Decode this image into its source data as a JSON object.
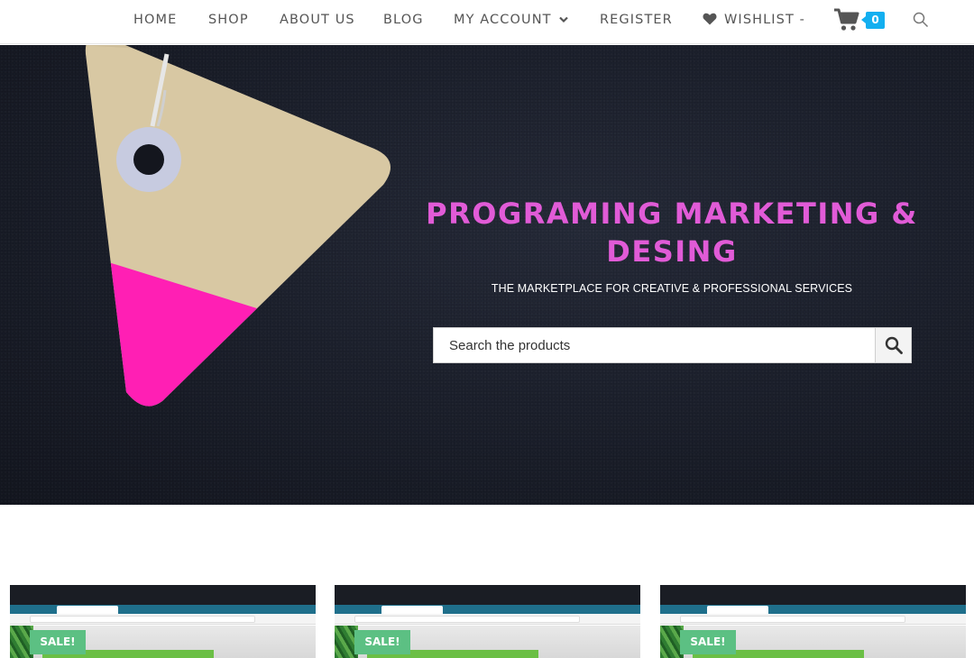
{
  "nav": {
    "items": [
      {
        "label": "HOME"
      },
      {
        "label": "SHOP"
      },
      {
        "label": "ABOUT US"
      },
      {
        "label": "BLOG"
      },
      {
        "label": "MY ACCOUNT"
      },
      {
        "label": "REGISTER"
      },
      {
        "label": "WISHLIST -"
      }
    ],
    "cart_count": "0",
    "icons": [
      "chevron-down-icon",
      "heart-icon",
      "cart-icon",
      "search-icon"
    ]
  },
  "hero": {
    "title": "PROGRAMING MARKETING & DESING",
    "subtitle": "THE MARKETPLACE FOR CREATIVE & PROFESSIONAL SERVICES",
    "search": {
      "placeholder": "Search the products"
    }
  },
  "products": [
    {
      "badge": "SALE!"
    },
    {
      "badge": "SALE!"
    },
    {
      "badge": "SALE!"
    }
  ],
  "colors": {
    "accent": "#e15bd7",
    "hero_bg": "#1c202c",
    "tag_beige": "#d8c8a3",
    "tag_pink": "#ff1fb4",
    "cart_badge": "#13aff0",
    "sale_badge": "#5cc083",
    "nav_text": "#555555"
  }
}
